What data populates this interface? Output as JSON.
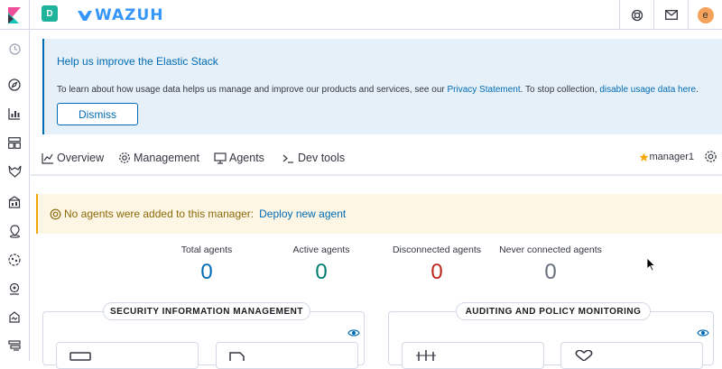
{
  "header": {
    "space_initial": "D",
    "brand": "WAZUH",
    "icons": [
      "help-icon",
      "mail-icon"
    ],
    "user_initial": "e"
  },
  "sidebar": {
    "icons": [
      "recent-icon",
      "discover-icon",
      "visualize-icon",
      "dashboard-icon",
      "wazuh-icon",
      "canvas-icon",
      "maps-icon",
      "ml-icon",
      "apm-icon",
      "uptime-icon",
      "management-icon"
    ]
  },
  "callout": {
    "title": "Help us improve the Elastic Stack",
    "body_prefix": "To learn about how usage data helps us manage and improve our products and services, see our ",
    "privacy_link": "Privacy Statement",
    "body_middle": ". To stop collection, ",
    "disable_link": "disable usage data here",
    "body_suffix": ".",
    "dismiss_label": "Dismiss"
  },
  "tabs": [
    {
      "label": "Overview",
      "icon": "overview-icon"
    },
    {
      "label": "Management",
      "icon": "gear-icon"
    },
    {
      "label": "Agents",
      "icon": "monitor-icon"
    },
    {
      "label": "Dev tools",
      "icon": "console-icon"
    }
  ],
  "manager": {
    "label": "manager1",
    "icon": "star-icon"
  },
  "warning": {
    "text": "No agents were added to this manager:",
    "link": "Deploy new agent"
  },
  "stats": [
    {
      "label": "Total agents",
      "value": "0",
      "color": "#006bb4"
    },
    {
      "label": "Active agents",
      "value": "0",
      "color": "#017d73"
    },
    {
      "label": "Disconnected agents",
      "value": "0",
      "color": "#bd271e"
    },
    {
      "label": "Never connected agents",
      "value": "0",
      "color": "#69707d"
    }
  ],
  "panels": [
    {
      "title": "SECURITY INFORMATION MANAGEMENT"
    },
    {
      "title": "AUDITING AND POLICY MONITORING"
    }
  ],
  "colors": {
    "accent": "#006bb4",
    "brand": "#3595f9",
    "warning_bg": "#fef6e5"
  }
}
